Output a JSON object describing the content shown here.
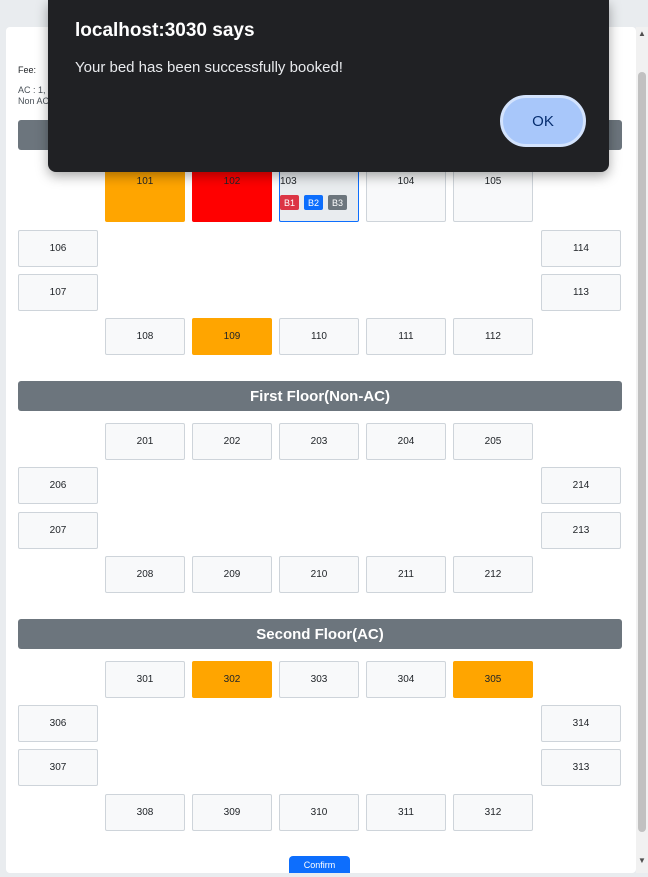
{
  "fee": {
    "label": "Fee:",
    "line1": "AC : 1,",
    "line2": "Non AC"
  },
  "floors": {
    "ground": {
      "rooms": {
        "101": "101",
        "102": "102",
        "103": "103",
        "104": "104",
        "105": "105",
        "106": "106",
        "107": "107",
        "108": "108",
        "109": "109",
        "110": "110",
        "111": "111",
        "112": "112",
        "113": "113",
        "114": "114"
      },
      "beds": {
        "b1": "B1",
        "b2": "B2",
        "b3": "B3"
      }
    },
    "first": {
      "title": "First Floor(Non-AC)",
      "rooms": {
        "201": "201",
        "202": "202",
        "203": "203",
        "204": "204",
        "205": "205",
        "206": "206",
        "207": "207",
        "208": "208",
        "209": "209",
        "210": "210",
        "211": "211",
        "212": "212",
        "213": "213",
        "214": "214"
      }
    },
    "second": {
      "title": "Second Floor(AC)",
      "rooms": {
        "301": "301",
        "302": "302",
        "303": "303",
        "304": "304",
        "305": "305",
        "306": "306",
        "307": "307",
        "308": "308",
        "309": "309",
        "310": "310",
        "311": "311",
        "312": "312",
        "313": "313",
        "314": "314"
      }
    }
  },
  "confirm_label": "Confirm",
  "alert": {
    "title": "localhost:3030 says",
    "message": "Your bed has been successfully booked!",
    "ok_label": "OK"
  },
  "colors": {
    "occupied_partial": "#ffa500",
    "occupied_full": "#ff0000",
    "selected_border": "#0d6efd",
    "floor_header": "#6c757d"
  }
}
